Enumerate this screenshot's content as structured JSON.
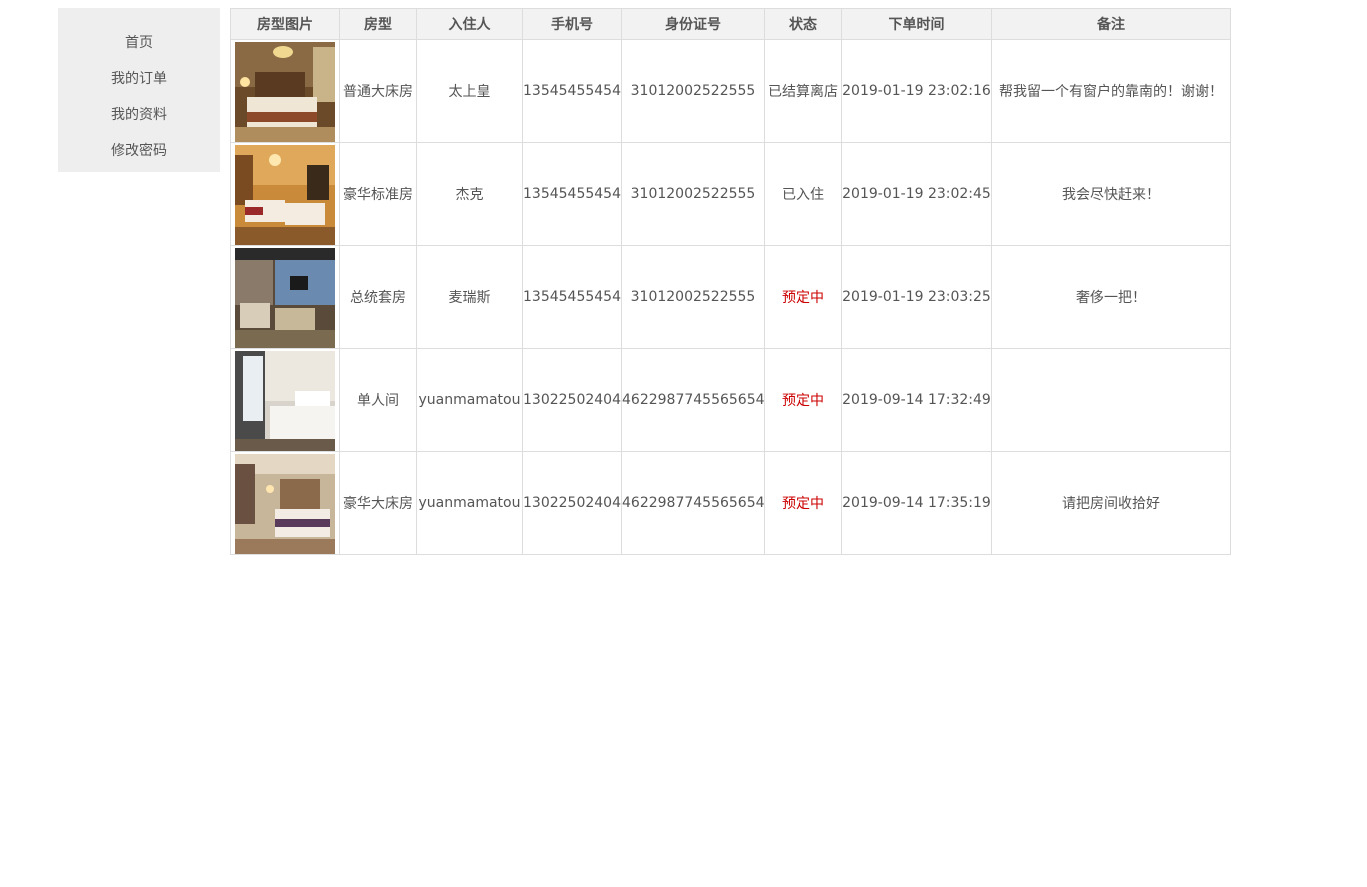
{
  "sidebar": {
    "items": [
      {
        "label": "首页"
      },
      {
        "label": "我的订单"
      },
      {
        "label": "我的资料"
      },
      {
        "label": "修改密码"
      }
    ]
  },
  "table": {
    "headers": [
      "房型图片",
      "房型",
      "入住人",
      "手机号",
      "身份证号",
      "状态",
      "下单时间",
      "备注"
    ],
    "rows": [
      {
        "room_type": "普通大床房",
        "guest": "太上皇",
        "phone": "13545455454",
        "id_number": "31012002522555",
        "status": "已结算离店",
        "order_time": "2019-01-19 23:02:16",
        "note": "帮我留一个有窗户的靠南的！谢谢！"
      },
      {
        "room_type": "豪华标准房",
        "guest": "杰克",
        "phone": "13545455454",
        "id_number": "31012002522555",
        "status": "已入住",
        "order_time": "2019-01-19 23:02:45",
        "note": "我会尽快赶来！"
      },
      {
        "room_type": "总统套房",
        "guest": "麦瑞斯",
        "phone": "13545455454",
        "id_number": "31012002522555",
        "status": "预定中",
        "order_time": "2019-01-19 23:03:25",
        "note": "奢侈一把！"
      },
      {
        "room_type": "单人间",
        "guest": "yuanmamatou",
        "phone": "13022502404",
        "id_number": "4622987745565654",
        "status": "预定中",
        "order_time": "2019-09-14 17:32:49",
        "note": ""
      },
      {
        "room_type": "豪华大床房",
        "guest": "yuanmamatou",
        "phone": "13022502404",
        "id_number": "4622987745565654",
        "status": "预定中",
        "order_time": "2019-09-14 17:35:19",
        "note": "请把房间收拾好"
      }
    ]
  },
  "colors": {
    "booked_status": "#cc0000",
    "text": "#555555",
    "sidebar_bg": "#eeeeee",
    "header_bg": "#f2f2f2",
    "border": "#dddddd"
  }
}
